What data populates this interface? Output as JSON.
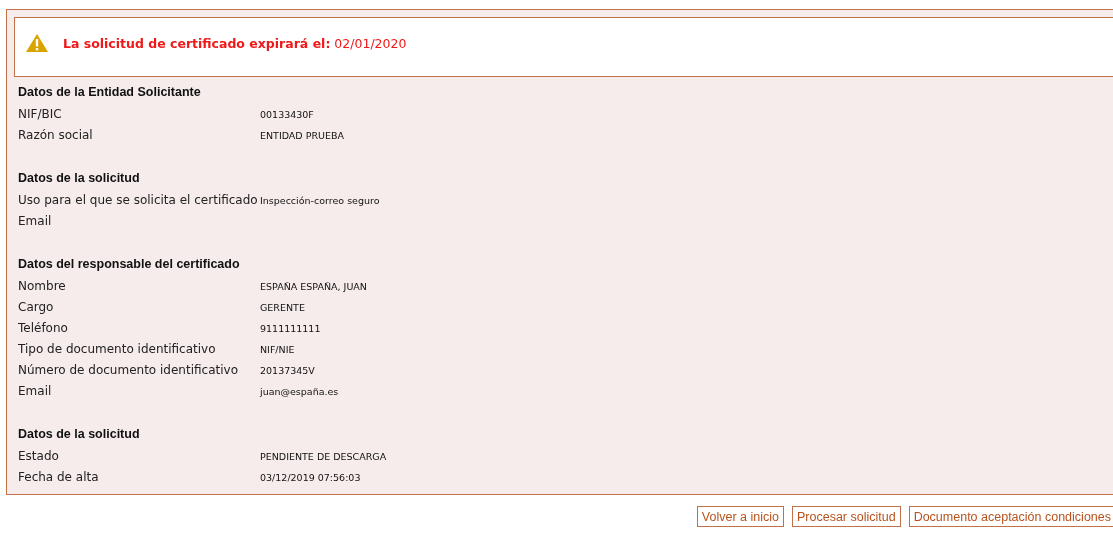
{
  "alert": {
    "message": "**La solicitud de certificado expirará el:** 02/01/2020"
  },
  "sections": [
    {
      "title": "Datos de la Entidad Solicitante",
      "rows": [
        {
          "label": "NIF/BIC",
          "value": "00133430F"
        },
        {
          "label": "Razón social",
          "value": "ENTIDAD PRUEBA"
        }
      ]
    },
    {
      "title": "Datos de la solicitud",
      "rows": [
        {
          "label": "Uso para el que se solicita el certificado",
          "value": "Inspección-correo seguro"
        },
        {
          "label": "Email"
        }
      ]
    },
    {
      "title": "Datos del responsable del certificado",
      "rows": [
        {
          "label": "Nombre",
          "value": "ESPAÑA ESPAÑA, JUAN"
        },
        {
          "label": "Cargo",
          "value": "GERENTE"
        },
        {
          "label": "Teléfono",
          "value": "9111111111"
        },
        {
          "label": "Tipo de documento identificativo",
          "value": "NIF/NIE"
        },
        {
          "label": "Número de documento identificativo",
          "value": "20137345V"
        },
        {
          "label": "Email",
          "value": "juan@españa.es"
        }
      ]
    },
    {
      "title": "Datos de la solicitud",
      "rows": [
        {
          "label": "Estado",
          "value": "PENDIENTE DE DESCARGA"
        },
        {
          "label": "Fecha de alta",
          "value": "03/12/2019 07:56:03"
        }
      ]
    }
  ],
  "buttons": [
    "Volver a inicio",
    "Procesar solicitud",
    "Documento aceptación condiciones"
  ]
}
